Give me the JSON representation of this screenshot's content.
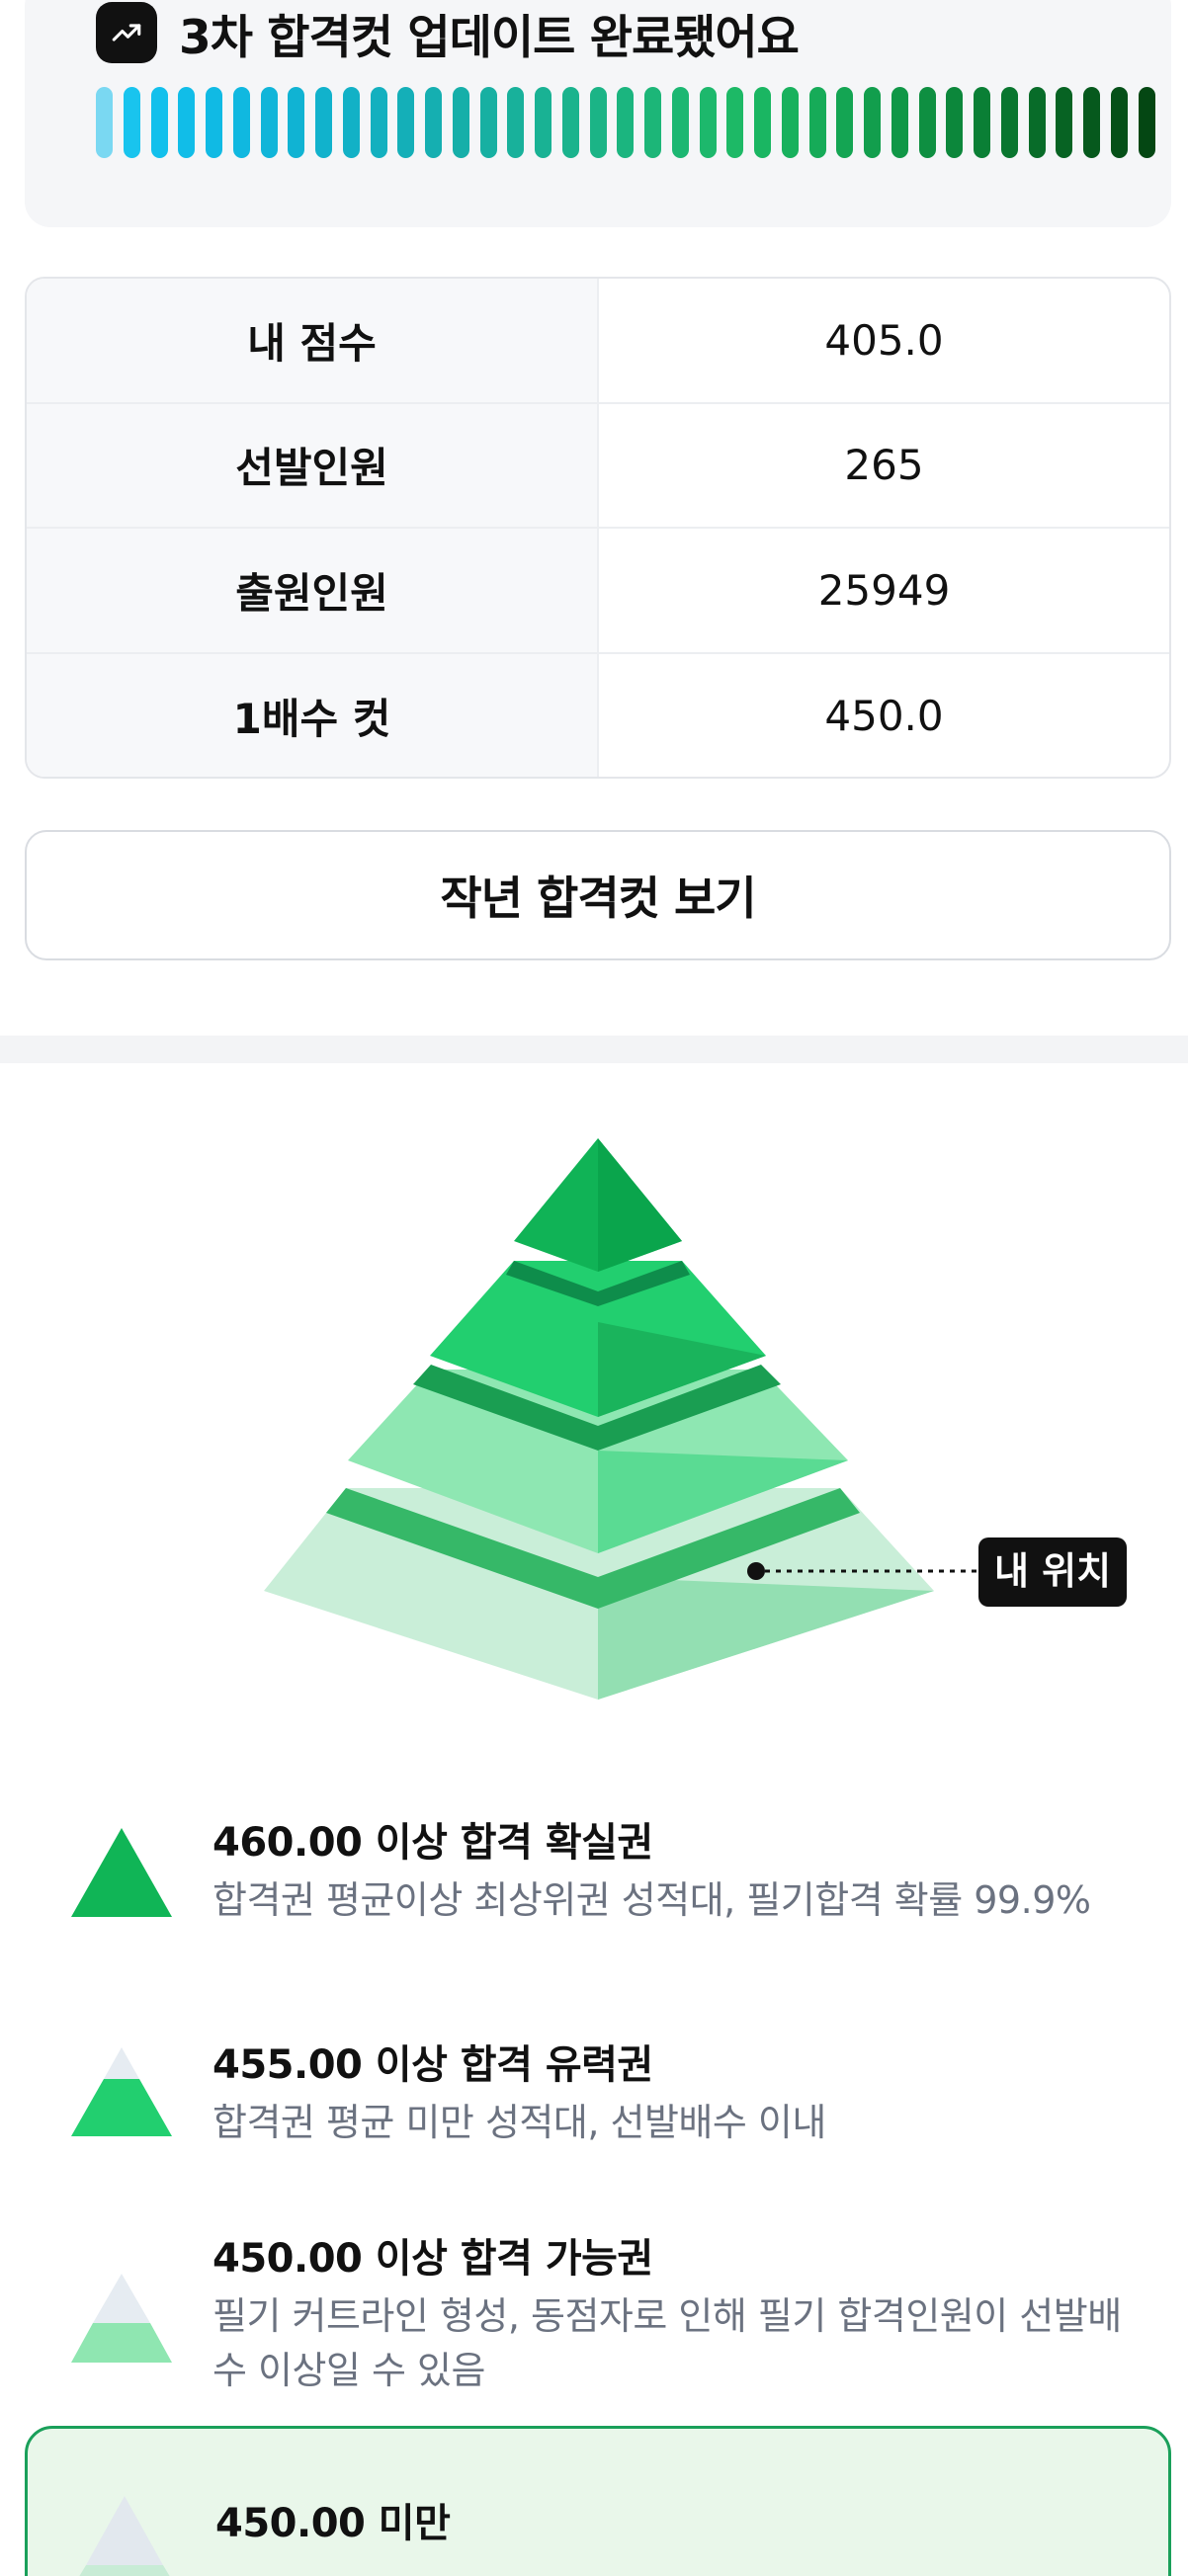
{
  "status": {
    "icon": "trend-up-icon",
    "title": "3차 합격컷 업데이트 완료됐어요",
    "bar_colors": [
      "#7ad8f2",
      "#19c4ee",
      "#12c0ec",
      "#11bde8",
      "#10bae4",
      "#10b8e0",
      "#10b5d9",
      "#10b3d3",
      "#11b2cc",
      "#12b1c6",
      "#13b0bf",
      "#14afb8",
      "#15afb1",
      "#16afa9",
      "#17b0a2",
      "#18b19b",
      "#19b294",
      "#1ab38d",
      "#1bb486",
      "#1bb57f",
      "#1cb678",
      "#1cb772",
      "#1db86c",
      "#1db966",
      "#1ab662",
      "#18b15d",
      "#16ab58",
      "#14a553",
      "#129e4d",
      "#109747",
      "#0e8f41",
      "#0c873b",
      "#0a7f35",
      "#09762f",
      "#086c29",
      "#076323",
      "#06591d",
      "#055018",
      "#044713"
    ]
  },
  "info_table": {
    "rows": [
      {
        "label": "내 점수",
        "value": "405.0"
      },
      {
        "label": "선발인원",
        "value": "265"
      },
      {
        "label": "출원인원",
        "value": "25949"
      },
      {
        "label": "1배수 컷",
        "value": "450.0"
      }
    ]
  },
  "last_year_button": "작년 합격컷 보기",
  "pyramid": {
    "my_position_label": "내 위치",
    "colors": {
      "tier1": "#10b456",
      "tier2": "#22cc6e",
      "tier3": "#8ee6b0",
      "tier4": "#c8ecd6"
    }
  },
  "levels": [
    {
      "title": "460.00 이상 합격 확실권",
      "desc": "합격권 평균이상 최상위권 성적대, 필기합격 확률 99.9%",
      "icon": "pyramid-top-tier-icon"
    },
    {
      "title": "455.00 이상 합격 유력권",
      "desc": "합격권 평균 미만 성적대, 선발배수 이내",
      "icon": "pyramid-second-tier-icon"
    },
    {
      "title": "450.00 이상 합격 가능권",
      "desc": "필기 커트라인 형성, 동점자로 인해 필기 합격인원이 선발배수 이상일 수 있음",
      "icon": "pyramid-third-tier-icon"
    },
    {
      "title": "450.00 미만",
      "icon": "pyramid-bottom-tier-icon"
    }
  ]
}
